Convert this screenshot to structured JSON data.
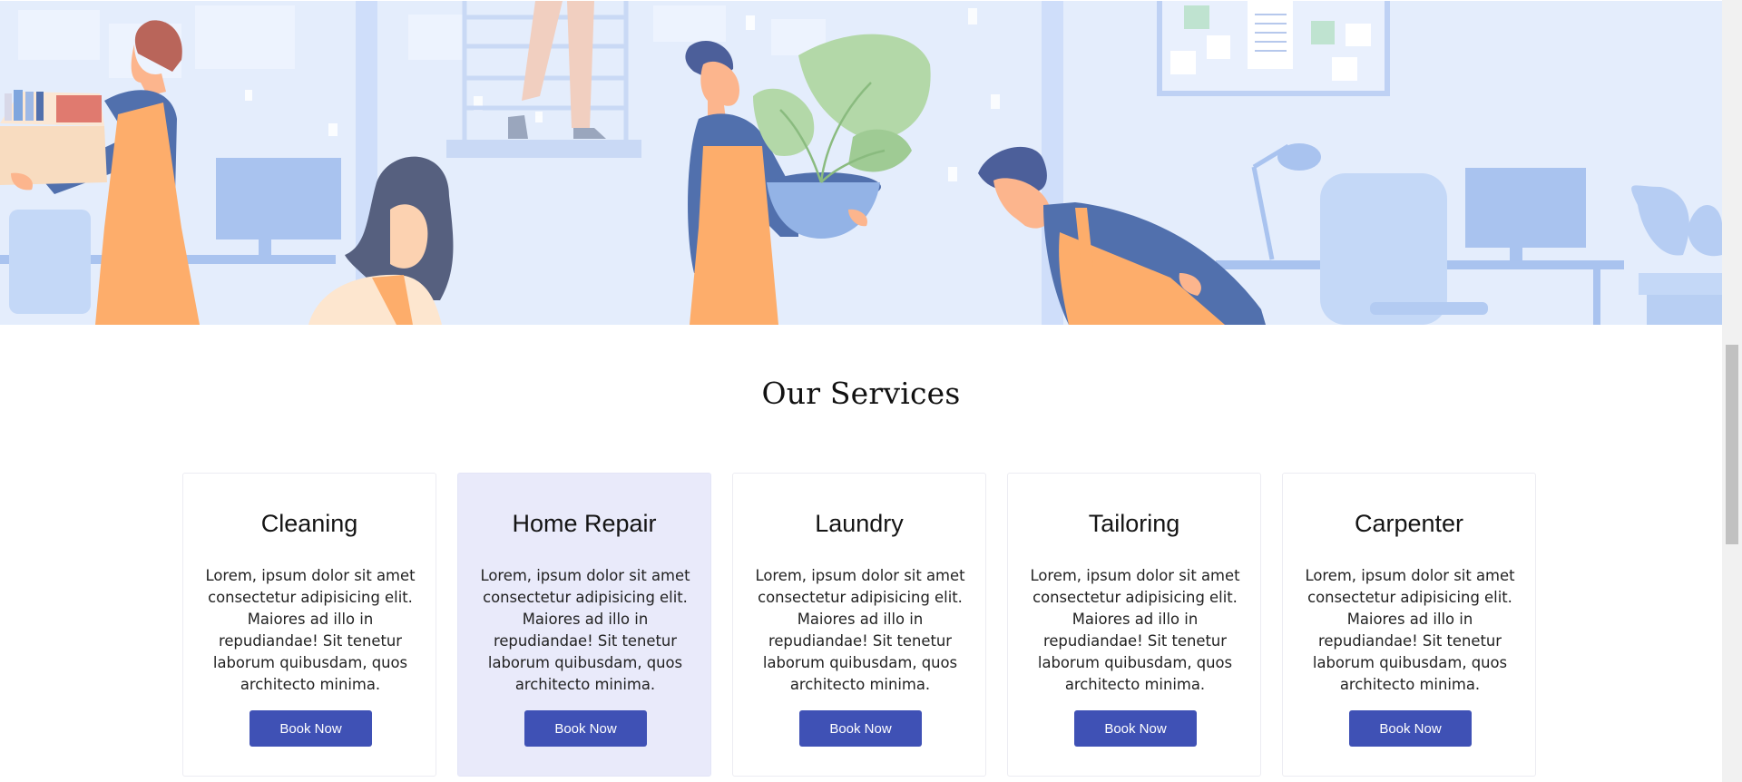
{
  "hero": {
    "illustration": "office-movers-illustration",
    "colors": {
      "background": "#e4edfc",
      "blue": "#5170ad",
      "orange": "#fdad6b",
      "plant": "#b3d8a8"
    }
  },
  "services": {
    "title": "Our Services",
    "cards": [
      {
        "title": "Cleaning",
        "description": "Lorem, ipsum dolor sit amet consectetur adipisicing elit. Maiores ad illo in repudiandae! Sit tenetur laborum quibusdam, quos architecto minima.",
        "button_label": "Book Now"
      },
      {
        "title": "Home Repair",
        "description": "Lorem, ipsum dolor sit amet consectetur adipisicing elit. Maiores ad illo in repudiandae! Sit tenetur laborum quibusdam, quos architecto minima.",
        "button_label": "Book Now"
      },
      {
        "title": "Laundry",
        "description": "Lorem, ipsum dolor sit amet consectetur adipisicing elit. Maiores ad illo in repudiandae! Sit tenetur laborum quibusdam, quos architecto minima.",
        "button_label": "Book Now"
      },
      {
        "title": "Tailoring",
        "description": "Lorem, ipsum dolor sit amet consectetur adipisicing elit. Maiores ad illo in repudiandae! Sit tenetur laborum quibusdam, quos architecto minima.",
        "button_label": "Book Now"
      },
      {
        "title": "Carpenter",
        "description": "Lorem, ipsum dolor sit amet consectetur adipisicing elit. Maiores ad illo in repudiandae! Sit tenetur laborum quibusdam, quos architecto minima.",
        "button_label": "Book Now"
      }
    ],
    "colors": {
      "button": "#3f51b5",
      "highlight_card": "#e9eafa"
    }
  }
}
